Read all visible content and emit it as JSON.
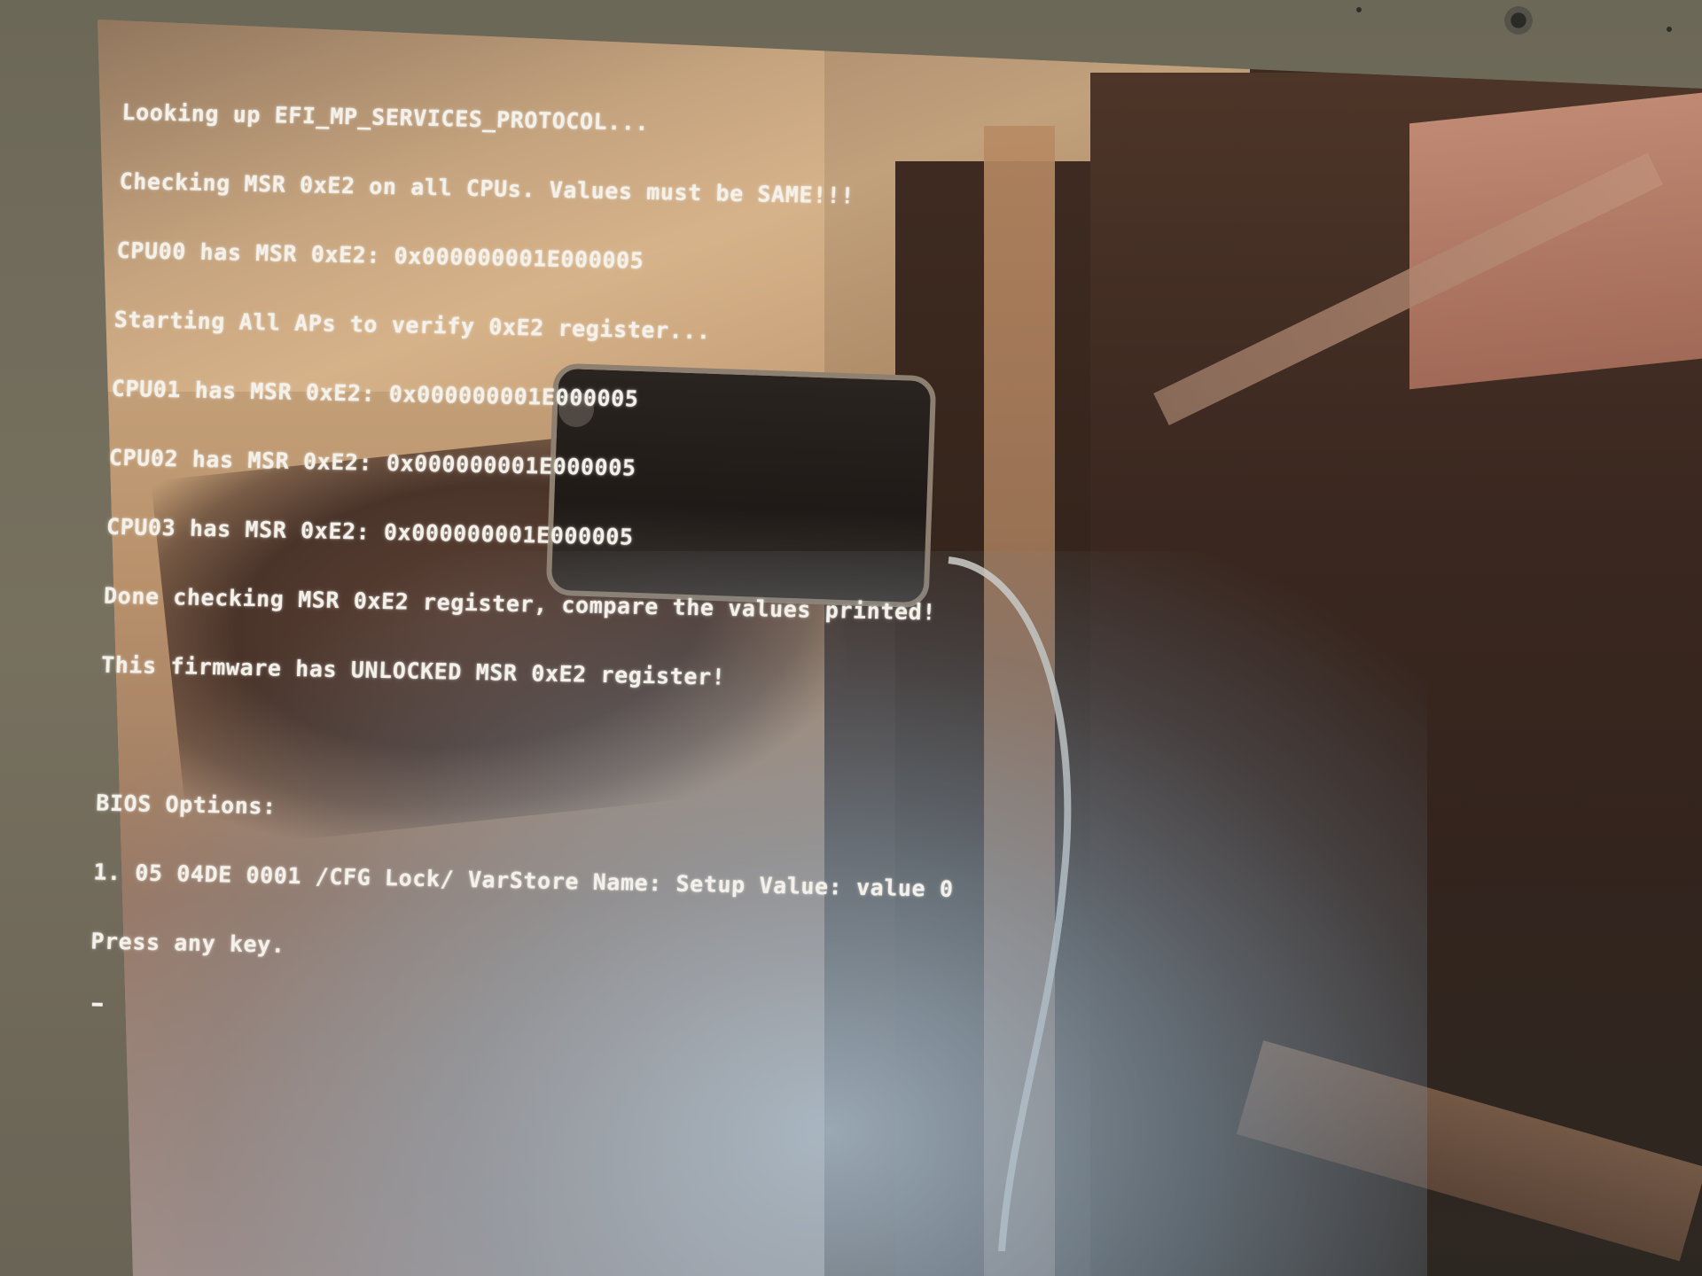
{
  "terminal": {
    "lines": [
      "Looking up EFI_MP_SERVICES_PROTOCOL...",
      "Checking MSR 0xE2 on all CPUs. Values must be SAME!!!",
      "CPU00 has MSR 0xE2: 0x000000001E000005",
      "Starting All APs to verify 0xE2 register...",
      "CPU01 has MSR 0xE2: 0x000000001E000005",
      "CPU02 has MSR 0xE2: 0x000000001E000005",
      "CPU03 has MSR 0xE2: 0x000000001E000005",
      "Done checking MSR 0xE2 register, compare the values printed!",
      "This firmware has UNLOCKED MSR 0xE2 register!"
    ],
    "bios_lines": [
      "BIOS Options:",
      "1. 05 04DE 0001 /CFG Lock/ VarStore Name: Setup Value: value 0",
      "Press any key."
    ],
    "cursor": "_"
  },
  "colors": {
    "text": "#f4f1ea",
    "bezel": "#6f6a5c"
  }
}
